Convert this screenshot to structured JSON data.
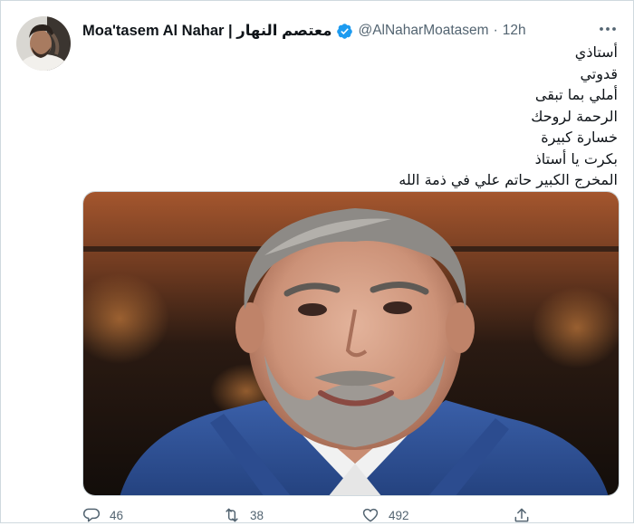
{
  "tweet": {
    "display_name": "Moa'tasem Al Nahar | معتصم النهار",
    "handle": "@AlNaharMoatasem",
    "separator": "·",
    "time": "12h",
    "lines": [
      "أستاذي",
      "قدوتي",
      "أملي بما تبقى",
      "الرحمة لروحك",
      "خسارة كبيرة",
      "بكرت يا أستاذ",
      "المخرج الكبير حاتم علي في ذمة الله"
    ],
    "actions": {
      "reply_count": "46",
      "retweet_count": "38",
      "like_count": "492"
    },
    "icons": {
      "verified": "verified-badge-icon",
      "more": "more-options-icon",
      "reply": "reply-icon",
      "retweet": "retweet-icon",
      "like": "heart-icon",
      "share": "share-icon"
    },
    "colors": {
      "verified_blue": "#1d9bf0",
      "secondary_text": "#536471"
    }
  }
}
